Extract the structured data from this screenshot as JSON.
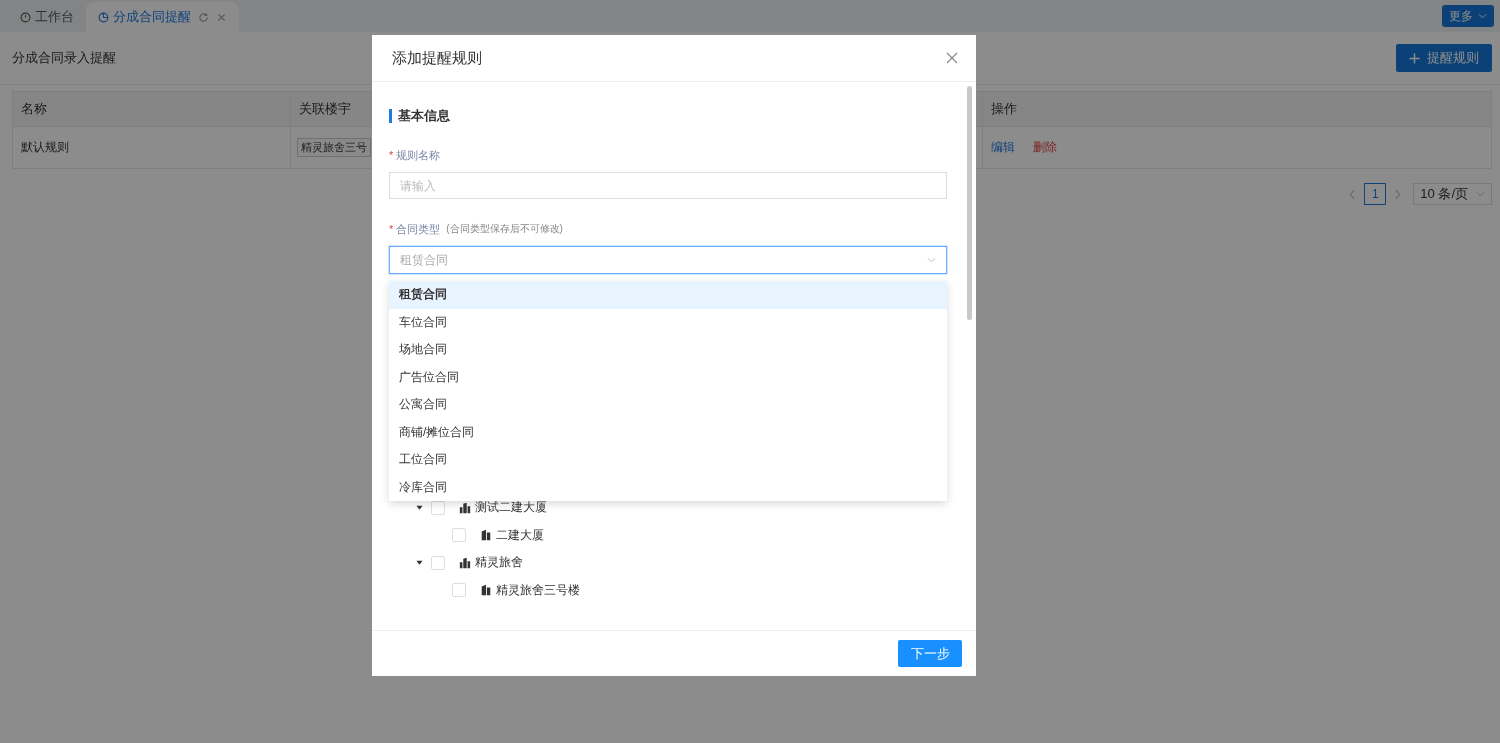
{
  "tabs": [
    {
      "label": "工作台",
      "selected": false
    },
    {
      "label": "分成合同提醒",
      "selected": true
    }
  ],
  "more_button": "更多",
  "page": {
    "title": "分成合同录入提醒",
    "add_button": "提醒规则"
  },
  "table": {
    "columns": [
      "名称",
      "关联楼宇",
      "操作"
    ],
    "rows": [
      {
        "name": "默认规则",
        "building": "精灵旅舍三号",
        "actions": [
          {
            "label": "编辑",
            "kind": "edit"
          },
          {
            "label": "删除",
            "kind": "delete"
          }
        ]
      }
    ]
  },
  "pagination": {
    "pages": [
      {
        "label": "1",
        "selected": true
      }
    ],
    "page_size": "10 条/页"
  },
  "dialog": {
    "title": "添加提醒规则",
    "section": "基本信息",
    "fields": [
      {
        "kind": "input",
        "label": "规则名称",
        "required_mark": "*",
        "placeholder": "请输入"
      },
      {
        "kind": "select",
        "label": "合同类型",
        "required_mark": "*",
        "hint": "(合同类型保存后不可修改)",
        "placeholder": "租赁合同",
        "open": true
      }
    ],
    "dropdown": [
      {
        "label": "租赁合同",
        "selected": true
      },
      {
        "label": "车位合同",
        "selected": false
      },
      {
        "label": "场地合同",
        "selected": false
      },
      {
        "label": "广告位合同",
        "selected": false
      },
      {
        "label": "公寓合同",
        "selected": false
      },
      {
        "label": "商铺/摊位合同",
        "selected": false
      },
      {
        "label": "工位合同",
        "selected": false
      },
      {
        "label": "冷库合同",
        "selected": false
      }
    ],
    "tree": [
      {
        "label": "测试二建大厦",
        "checked": false,
        "expanded": true,
        "children": [
          {
            "label": "二建大厦",
            "checked": false
          }
        ]
      },
      {
        "label": "精灵旅舍",
        "checked": false,
        "expanded": true,
        "children": [
          {
            "label": "精灵旅舍三号楼",
            "checked": false
          }
        ]
      }
    ],
    "next_button": "下一步"
  }
}
